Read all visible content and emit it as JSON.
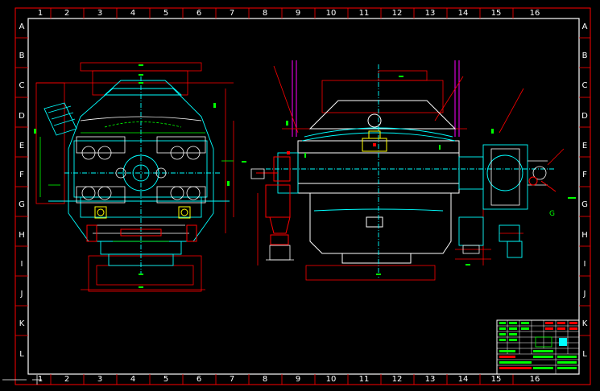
{
  "sheet": {
    "columns": [
      "1",
      "2",
      "3",
      "4",
      "5",
      "6",
      "7",
      "8",
      "9",
      "10",
      "11",
      "12",
      "13",
      "14",
      "15",
      "16"
    ],
    "rows": [
      "A",
      "B",
      "C",
      "D",
      "E",
      "F",
      "G",
      "H",
      "I",
      "J",
      "K",
      "L"
    ],
    "bottom_columns": [
      "1",
      "2",
      "3",
      "4",
      "5",
      "6",
      "7",
      "8",
      "9",
      "10",
      "11",
      "12",
      "13",
      "14",
      "15",
      "16"
    ]
  },
  "callouts": {
    "right_g": "G"
  },
  "colors": {
    "background": "#000000",
    "frame": "#ffffff",
    "border_red": "#ff0000",
    "cyan": "#00ffff",
    "green": "#00ff00",
    "yellow": "#ffff00",
    "magenta": "#ff00ff",
    "white": "#ffffff"
  },
  "views": {
    "left": "end-elevation-view",
    "right": "side-elevation-view"
  }
}
